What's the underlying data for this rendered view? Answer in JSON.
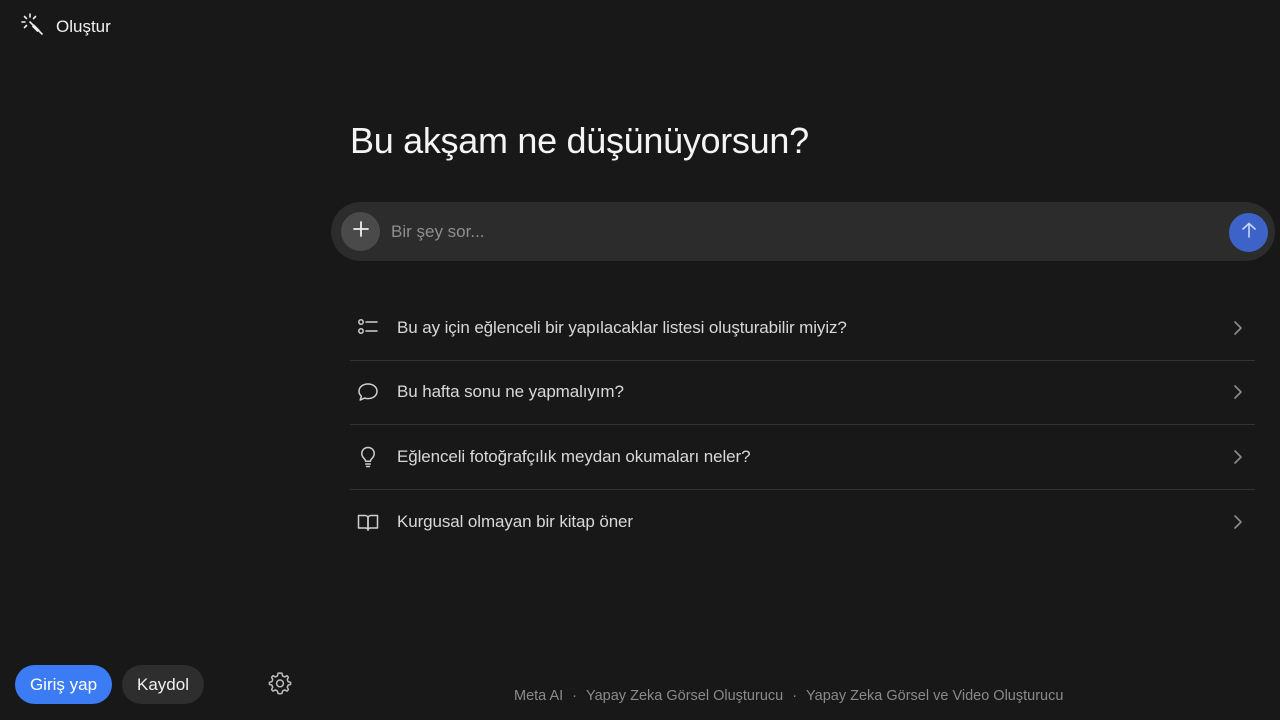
{
  "header": {
    "create_label": "Oluştur",
    "create_icon": "magic-wand-icon"
  },
  "main": {
    "headline": "Bu akşam ne düşünüyorsun?",
    "prompt": {
      "placeholder": "Bir şey sor...",
      "value": "",
      "attach_icon": "plus-icon",
      "send_icon": "arrow-up-icon",
      "send_color": "#3d63c9"
    },
    "suggestions": [
      {
        "icon": "checklist-icon",
        "text": "Bu ay için eğlenceli bir yapılacaklar listesi oluşturabilir miyiz?"
      },
      {
        "icon": "chat-bubble-icon",
        "text": "Bu hafta sonu ne yapmalıyım?"
      },
      {
        "icon": "lightbulb-icon",
        "text": "Eğlenceli fotoğrafçılık meydan okumaları neler?"
      },
      {
        "icon": "open-book-icon",
        "text": "Kurgusal olmayan bir kitap öner"
      }
    ]
  },
  "auth": {
    "login_label": "Giriş yap",
    "login_color": "#3b7cf5",
    "signup_label": "Kaydol",
    "settings_icon": "gear-icon"
  },
  "footer": {
    "links": [
      "Meta AI",
      "Yapay Zeka Görsel Oluşturucu",
      "Yapay Zeka Görsel ve Video Oluşturucu"
    ],
    "separator": "·"
  },
  "colors": {
    "background": "#181818",
    "prompt_bg": "#2c2c2c",
    "divider": "#333333"
  }
}
